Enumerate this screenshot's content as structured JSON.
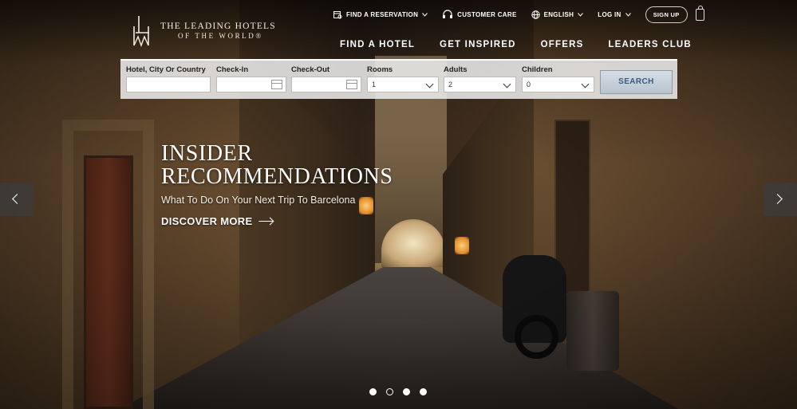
{
  "brand": {
    "name_line1": "THE LEADING HOTELS",
    "name_line2": "OF THE WORLD®",
    "monogram": "LHW"
  },
  "utility_nav": {
    "find_reservation": "FIND A RESERVATION",
    "customer_care": "CUSTOMER CARE",
    "language": "ENGLISH",
    "login": "LOG IN",
    "signup": "SIGN UP"
  },
  "main_nav": {
    "items": [
      "FIND A HOTEL",
      "GET INSPIRED",
      "OFFERS",
      "LEADERS CLUB"
    ]
  },
  "search": {
    "destination_label": "Hotel, City Or Country",
    "destination_value": "",
    "checkin_label": "Check-In",
    "checkin_value": "",
    "checkout_label": "Check-Out",
    "checkout_value": "",
    "rooms_label": "Rooms",
    "rooms_value": "1",
    "adults_label": "Adults",
    "adults_value": "2",
    "children_label": "Children",
    "children_value": "0",
    "button": "SEARCH"
  },
  "hero": {
    "title_line1": "INSIDER",
    "title_line2": "RECOMMENDATIONS",
    "subtitle": "What To Do On Your Next Trip To Barcelona",
    "cta": "DISCOVER MORE"
  },
  "slider": {
    "total": 4,
    "active_index": 1
  },
  "icons": {
    "reservation": "calendar-search-icon",
    "customer_care": "headset-icon",
    "language": "globe-icon",
    "bag": "shopping-bag-icon"
  }
}
